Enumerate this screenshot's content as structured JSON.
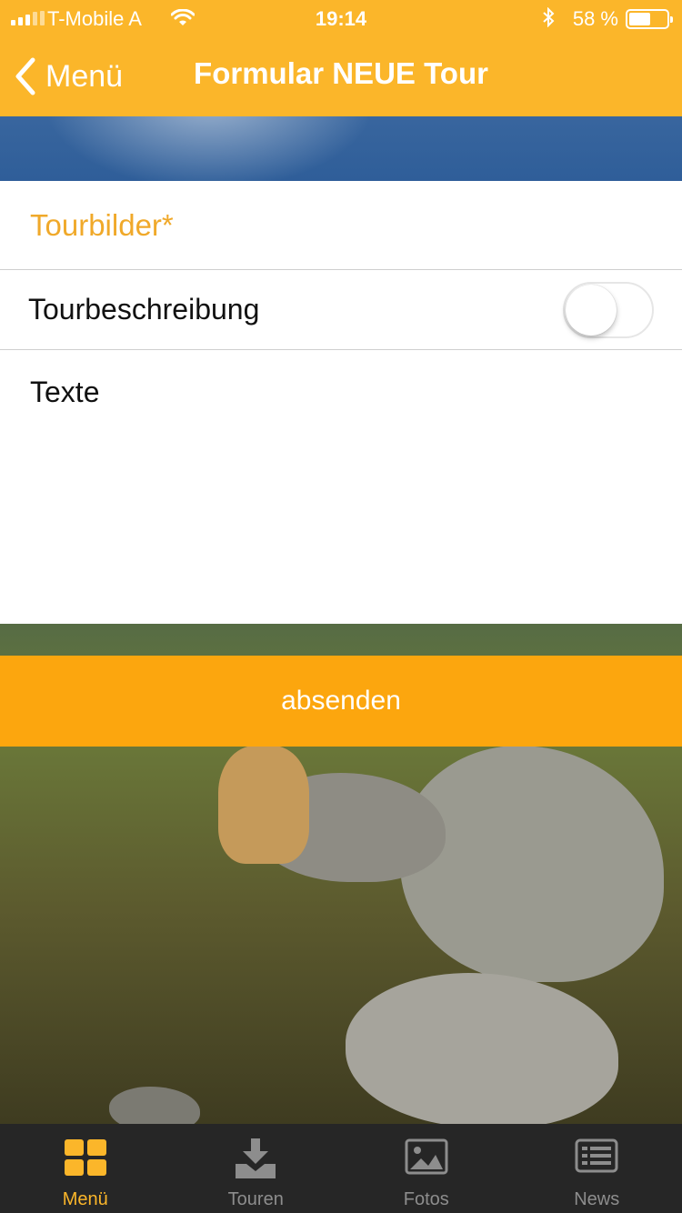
{
  "status_bar": {
    "carrier": "T-Mobile A",
    "time": "19:14",
    "battery_text": "58 %",
    "battery_level": 0.58
  },
  "nav": {
    "back_label": "Menü",
    "title": "Formular NEUE Tour"
  },
  "form": {
    "images_label": "Tourbilder*",
    "description_label": "Tourbeschreibung",
    "description_toggle_on": false,
    "text_label": "Texte"
  },
  "submit": {
    "label": "absenden"
  },
  "tabbar": {
    "items": [
      {
        "label": "Menü",
        "icon": "grid-icon",
        "active": true
      },
      {
        "label": "Touren",
        "icon": "download-icon",
        "active": false
      },
      {
        "label": "Fotos",
        "icon": "photo-icon",
        "active": false
      },
      {
        "label": "News",
        "icon": "news-icon",
        "active": false
      }
    ]
  },
  "colors": {
    "accent": "#fbb62a",
    "submit": "#fca60e",
    "tabbar": "#262626",
    "inactive_tab": "#8d8d8d"
  }
}
